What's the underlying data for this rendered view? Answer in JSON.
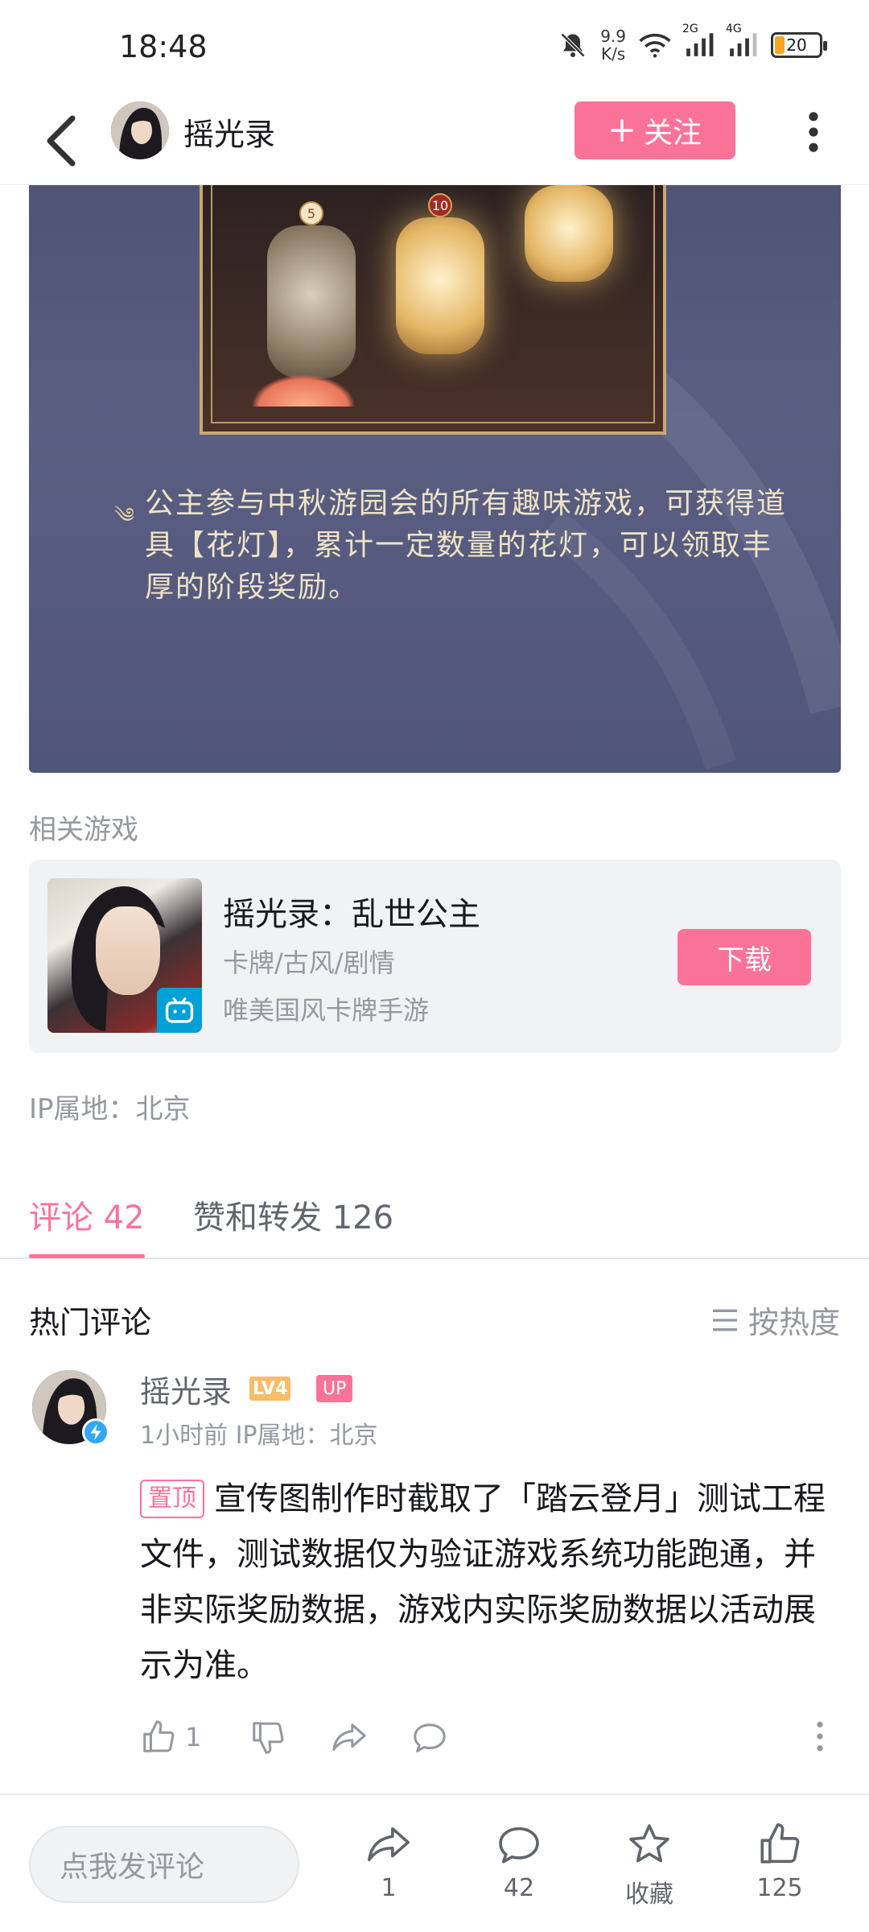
{
  "status_bar": {
    "time": "18:48",
    "net_speed_value": "9.9",
    "net_speed_unit": "K/s",
    "signal1_label": "2G",
    "signal2_label": "4G",
    "battery": "20"
  },
  "header": {
    "username": "摇光录",
    "follow_label": "关注"
  },
  "article": {
    "image_text": "公主参与中秋游园会的所有趣味游戏，可获得道具【花灯】，累计一定数量的花灯，可以领取丰厚的阶段奖励。",
    "lantern_badges": [
      "5",
      "10"
    ]
  },
  "related": {
    "section_label": "相关游戏",
    "game_title": "摇光录：乱世公主",
    "game_tags": "卡牌/古风/剧情",
    "game_desc": "唯美国风卡牌手游",
    "download_label": "下载"
  },
  "ip_location": "IP属地：北京",
  "tabs": {
    "comments": "评论 42",
    "reposts": "赞和转发 126"
  },
  "hot": {
    "title": "热门评论",
    "sort_label": "按热度"
  },
  "comment": {
    "username": "摇光录",
    "level": "LV4",
    "up_badge": "UP",
    "meta": "1小时前  IP属地：北京",
    "pin_tag": "置顶",
    "text": "宣传图制作时截取了「踏云登月」测试工程文件，测试数据仅为验证游戏系统功能跑通，并非实际奖励数据，游戏内实际奖励数据以活动展示为准。",
    "like_count": "1"
  },
  "bottom_bar": {
    "input_placeholder": "点我发评论",
    "share_count": "1",
    "comment_count": "42",
    "favorite_label": "收藏",
    "like_count": "125"
  },
  "colors": {
    "accent": "#fb7299",
    "muted": "#9499a0"
  },
  "icons": [
    "back-arrow-icon",
    "more-vertical-icon",
    "plus-icon",
    "sort-lines-icon",
    "thumb-up-icon",
    "thumb-down-icon",
    "share-icon",
    "comment-bubble-icon",
    "star-icon",
    "bilibili-tv-icon"
  ]
}
